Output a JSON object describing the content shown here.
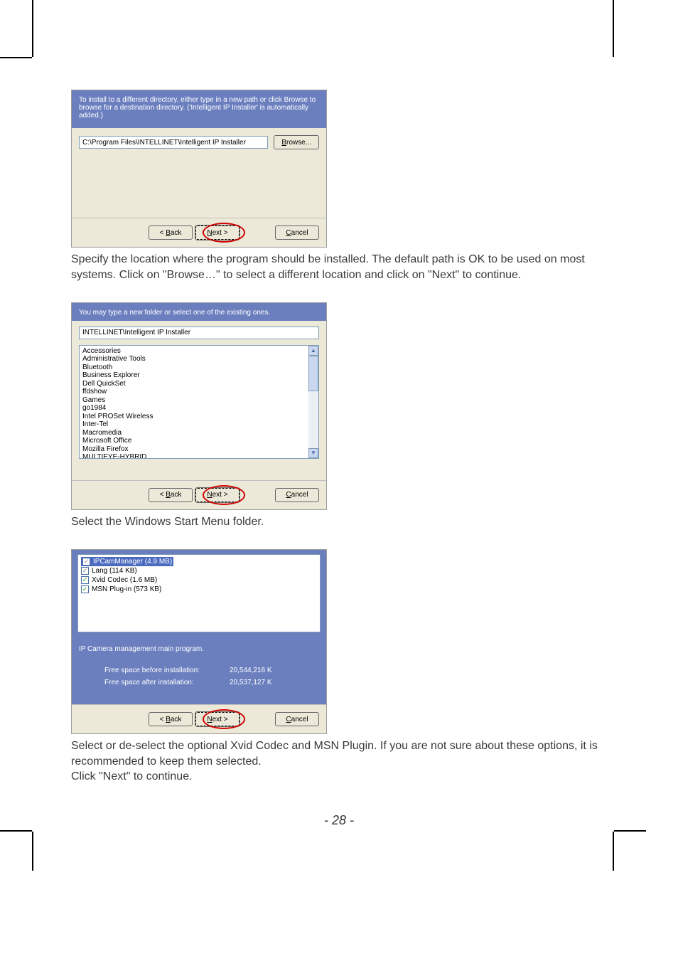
{
  "shot1": {
    "instruction": "To install to a different directory, either type in a new path or click Browse to browse for a destination directory. ('Intelligent IP Installer' is automatically added.)",
    "path": "C:\\Program Files\\INTELLINET\\Intelligent IP Installer",
    "browse": "Browse...",
    "back": "< Back",
    "next": "Next >",
    "cancel": "Cancel"
  },
  "text1": "Specify the location where the program should be installed. The default path is OK to be used on most systems. Click on \"Browse…\" to select a different location and click on \"Next\" to continue.",
  "shot2": {
    "instruction": "You may type a new folder or select one of the existing ones.",
    "folder": "INTELLINET\\Intelligent IP Installer",
    "items": [
      "Accessories",
      "Administrative Tools",
      "Bluetooth",
      "Business Explorer",
      "Dell QuickSet",
      "ffdshow",
      "Games",
      "go1984",
      "Intel PROSet Wireless",
      "Inter-Tel",
      "Macromedia",
      "Microsoft Office",
      "Mozilla Firefox",
      "MULTIEYE-HYBRID"
    ],
    "back": "< Back",
    "next": "Next >",
    "cancel": "Cancel"
  },
  "text2": "Select the Windows Start Menu folder.",
  "shot3": {
    "items": [
      {
        "label": "IPCamManager (4.9 MB)",
        "checked": true,
        "disabled": true,
        "selected": true
      },
      {
        "label": "Lang (114 KB)",
        "checked": true,
        "disabled": true,
        "selected": false
      },
      {
        "label": "Xvid Codec (1.6 MB)",
        "checked": true,
        "disabled": false,
        "selected": false
      },
      {
        "label": "MSN Plug-in (573 KB)",
        "checked": true,
        "disabled": false,
        "selected": false
      }
    ],
    "description": "IP Camera management main program.",
    "space_before_label": "Free space before installation:",
    "space_before_value": "20,544,216 K",
    "space_after_label": "Free space after installation:",
    "space_after_value": "20,537,127 K",
    "back": "< Back",
    "next": "Next >",
    "cancel": "Cancel"
  },
  "text3": "Select or de-select the optional Xvid Codec and MSN Plugin. If you are not sure about these options, it is recommended to keep them selected.",
  "text4": "Click \"Next\" to continue.",
  "page_number": "- 28 -"
}
